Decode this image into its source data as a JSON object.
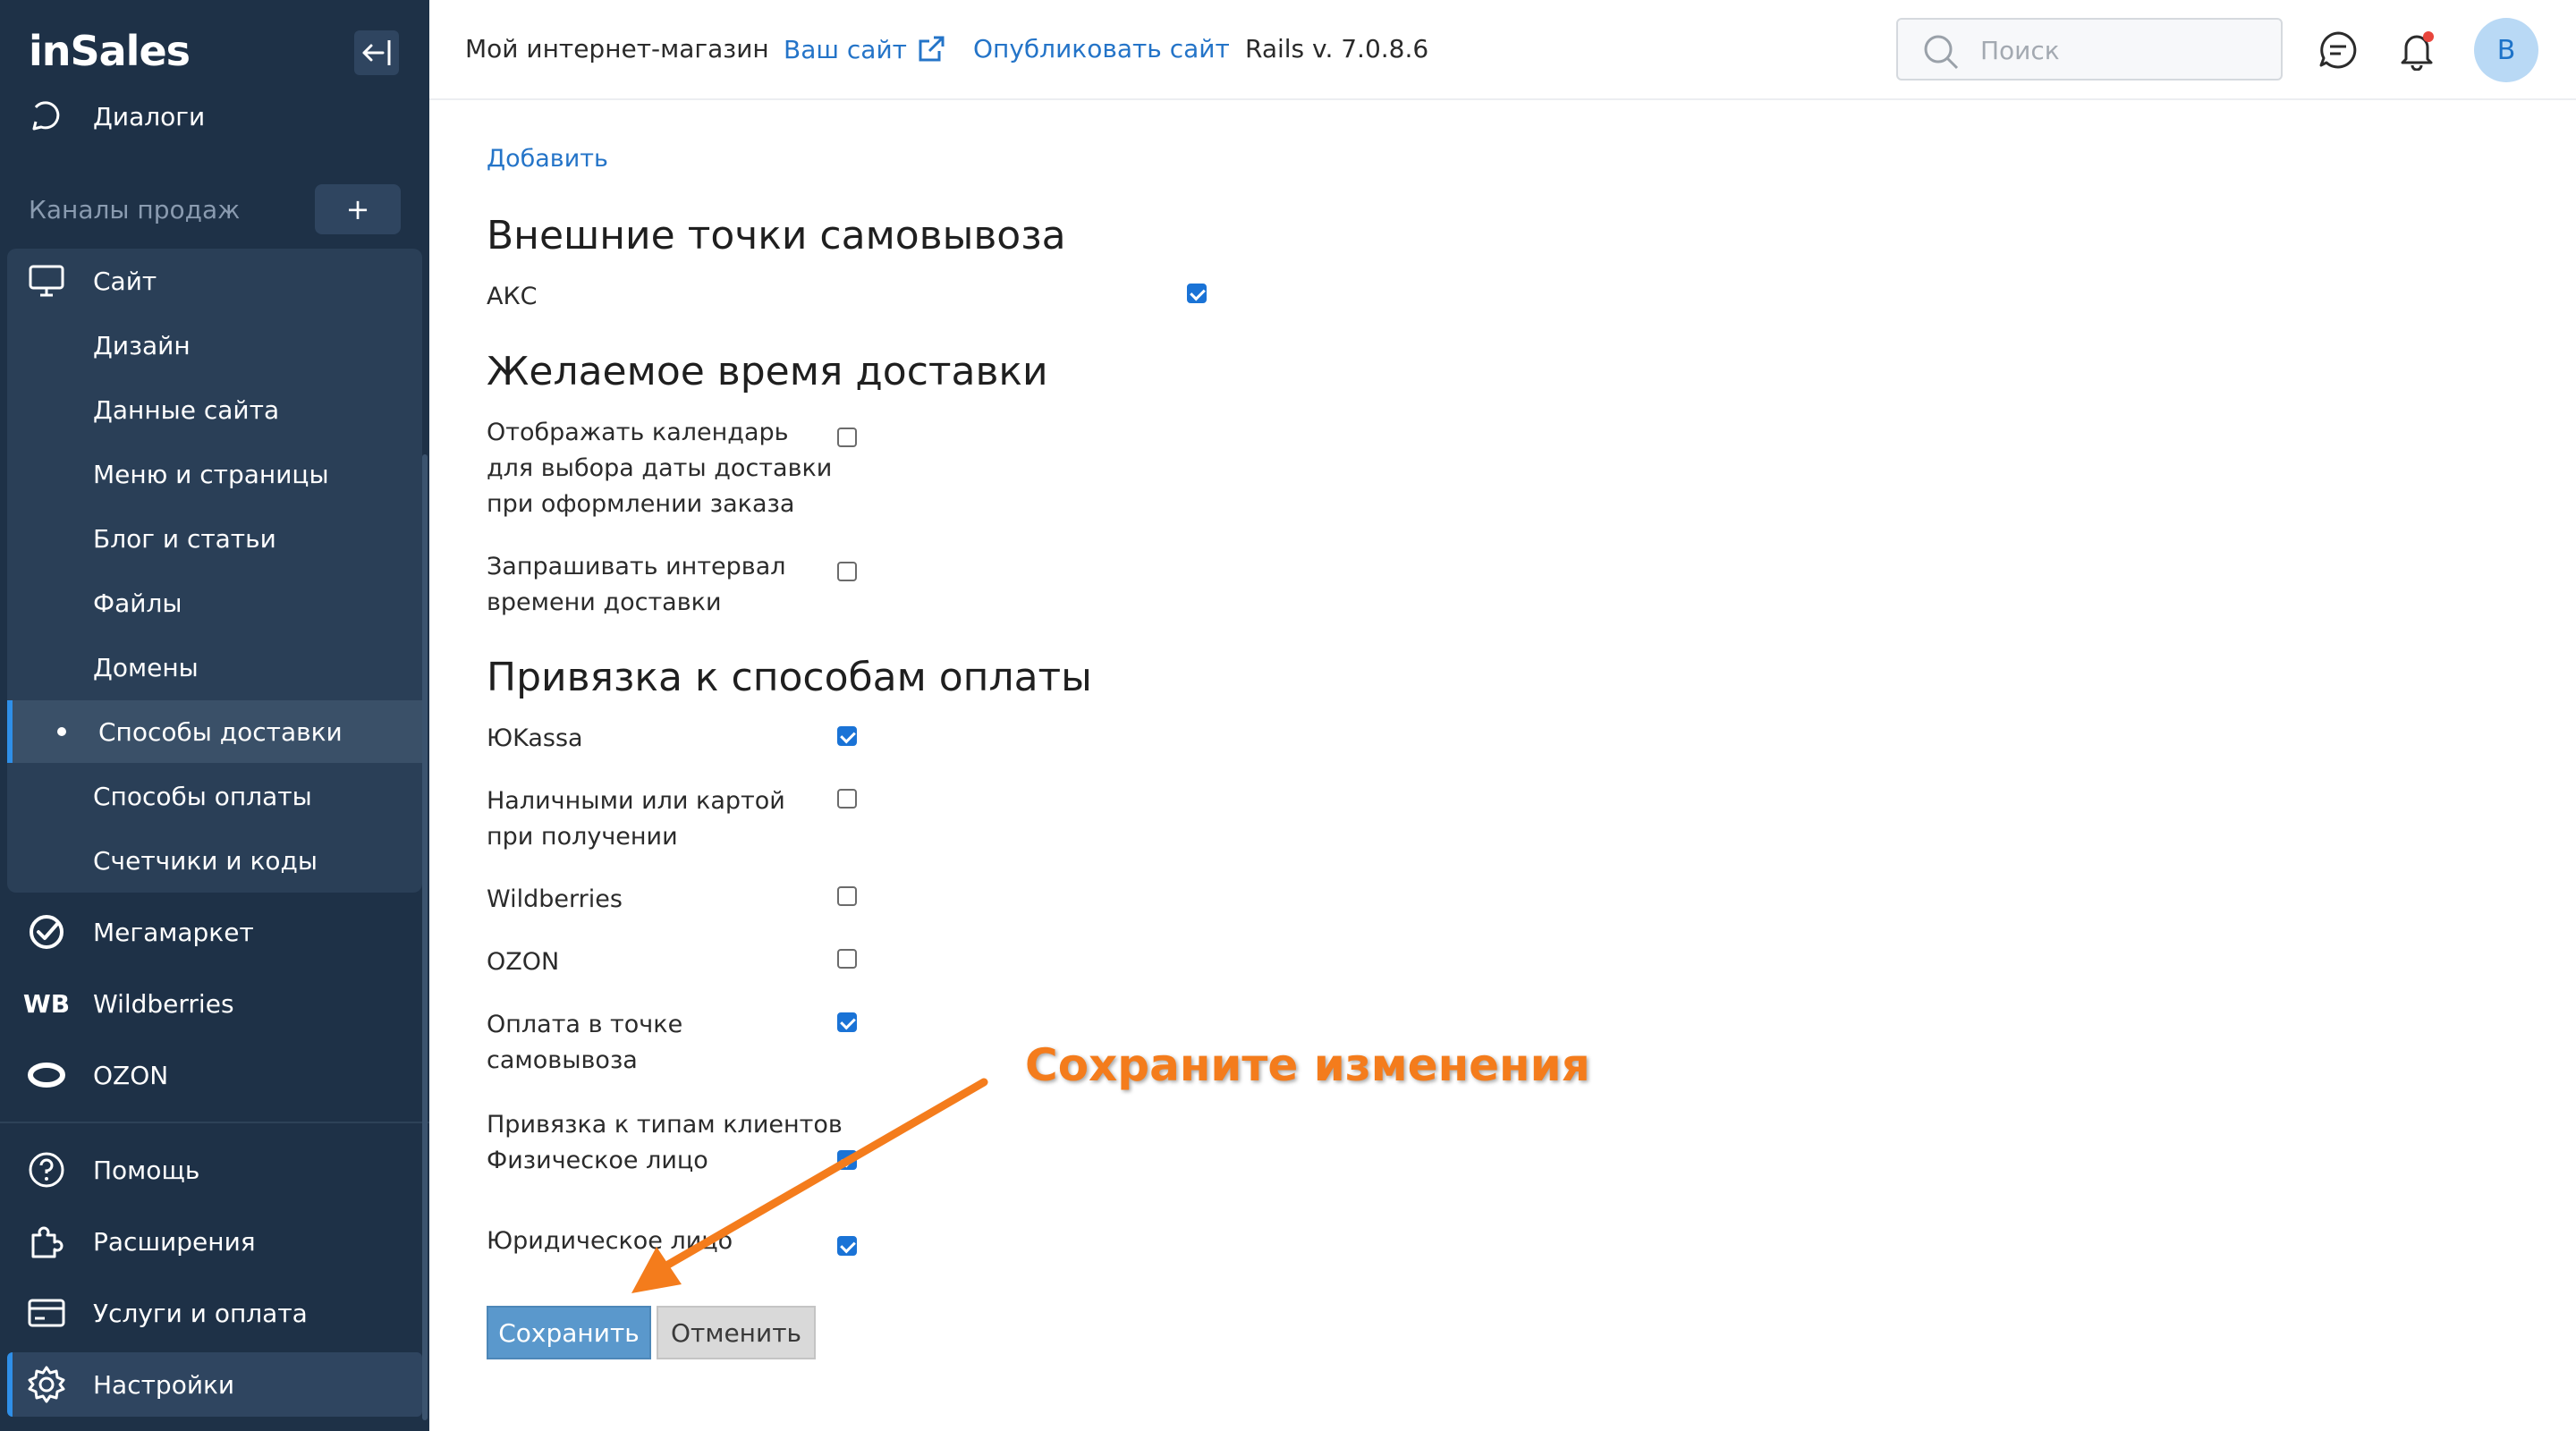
{
  "sidebar": {
    "logo": "inSales",
    "dialogs": "Диалоги",
    "channels_label": "Каналы продаж",
    "add_channel": "+",
    "site": "Сайт",
    "site_items": [
      "Дизайн",
      "Данные сайта",
      "Меню и страницы",
      "Блог и статьи",
      "Файлы",
      "Домены",
      "Способы доставки",
      "Способы оплаты",
      "Счетчики и коды"
    ],
    "active_item": "Способы доставки",
    "megamarket": "Мегамаркет",
    "wb_badge": "WB",
    "wildberries": "Wildberries",
    "ozon": "OZON",
    "help": "Помощь",
    "extensions": "Расширения",
    "services": "Услуги и оплата",
    "settings": "Настройки"
  },
  "header": {
    "store_name": "Мой интернет-магазин",
    "your_site": "Ваш сайт",
    "publish": "Опубликовать сайт",
    "rails_version": "Rails v. 7.0.8.6",
    "search_placeholder": "Поиск",
    "avatar_letter": "B"
  },
  "main": {
    "add_link": "Добавить",
    "external_title": "Внешние точки самовывоза",
    "external_items": [
      {
        "label": "АКС",
        "checked": true
      }
    ],
    "time_title": "Желаемое время доставки",
    "time_items": [
      {
        "label": "Отображать календарь для выбора даты доставки при оформлении заказа",
        "lines": [
          "Отображать календарь",
          "для выбора даты доставки",
          "при оформлении заказа"
        ],
        "checked": false
      },
      {
        "label": "Запрашивать интервал времени доставки",
        "lines": [
          "Запрашивать интервал",
          "времени доставки"
        ],
        "checked": false
      }
    ],
    "payment_title": "Привязка к способам оплаты",
    "payment_items": [
      {
        "lines": [
          "ЮKassa"
        ],
        "checked": true
      },
      {
        "lines": [
          "Наличными или картой",
          "при получении"
        ],
        "checked": false
      },
      {
        "lines": [
          "Wildberries"
        ],
        "checked": false
      },
      {
        "lines": [
          "OZON"
        ],
        "checked": false
      },
      {
        "lines": [
          "Оплата в точке",
          "самовывоза"
        ],
        "checked": true
      }
    ],
    "client_types_label": "Привязка к типам клиентов",
    "client_types": [
      {
        "label": "Физическое лицо",
        "checked": true
      },
      {
        "label": "Юридическое лицо",
        "checked": true
      }
    ],
    "save_label": "Сохранить",
    "cancel_label": "Отменить"
  },
  "annotation": {
    "text": "Сохраните изменения",
    "color": "#f47c1c"
  },
  "colors": {
    "sidebar_bg": "#1e3147",
    "accent": "#2f8fe8",
    "link": "#2474c8",
    "checkbox": "#1a73d6"
  }
}
